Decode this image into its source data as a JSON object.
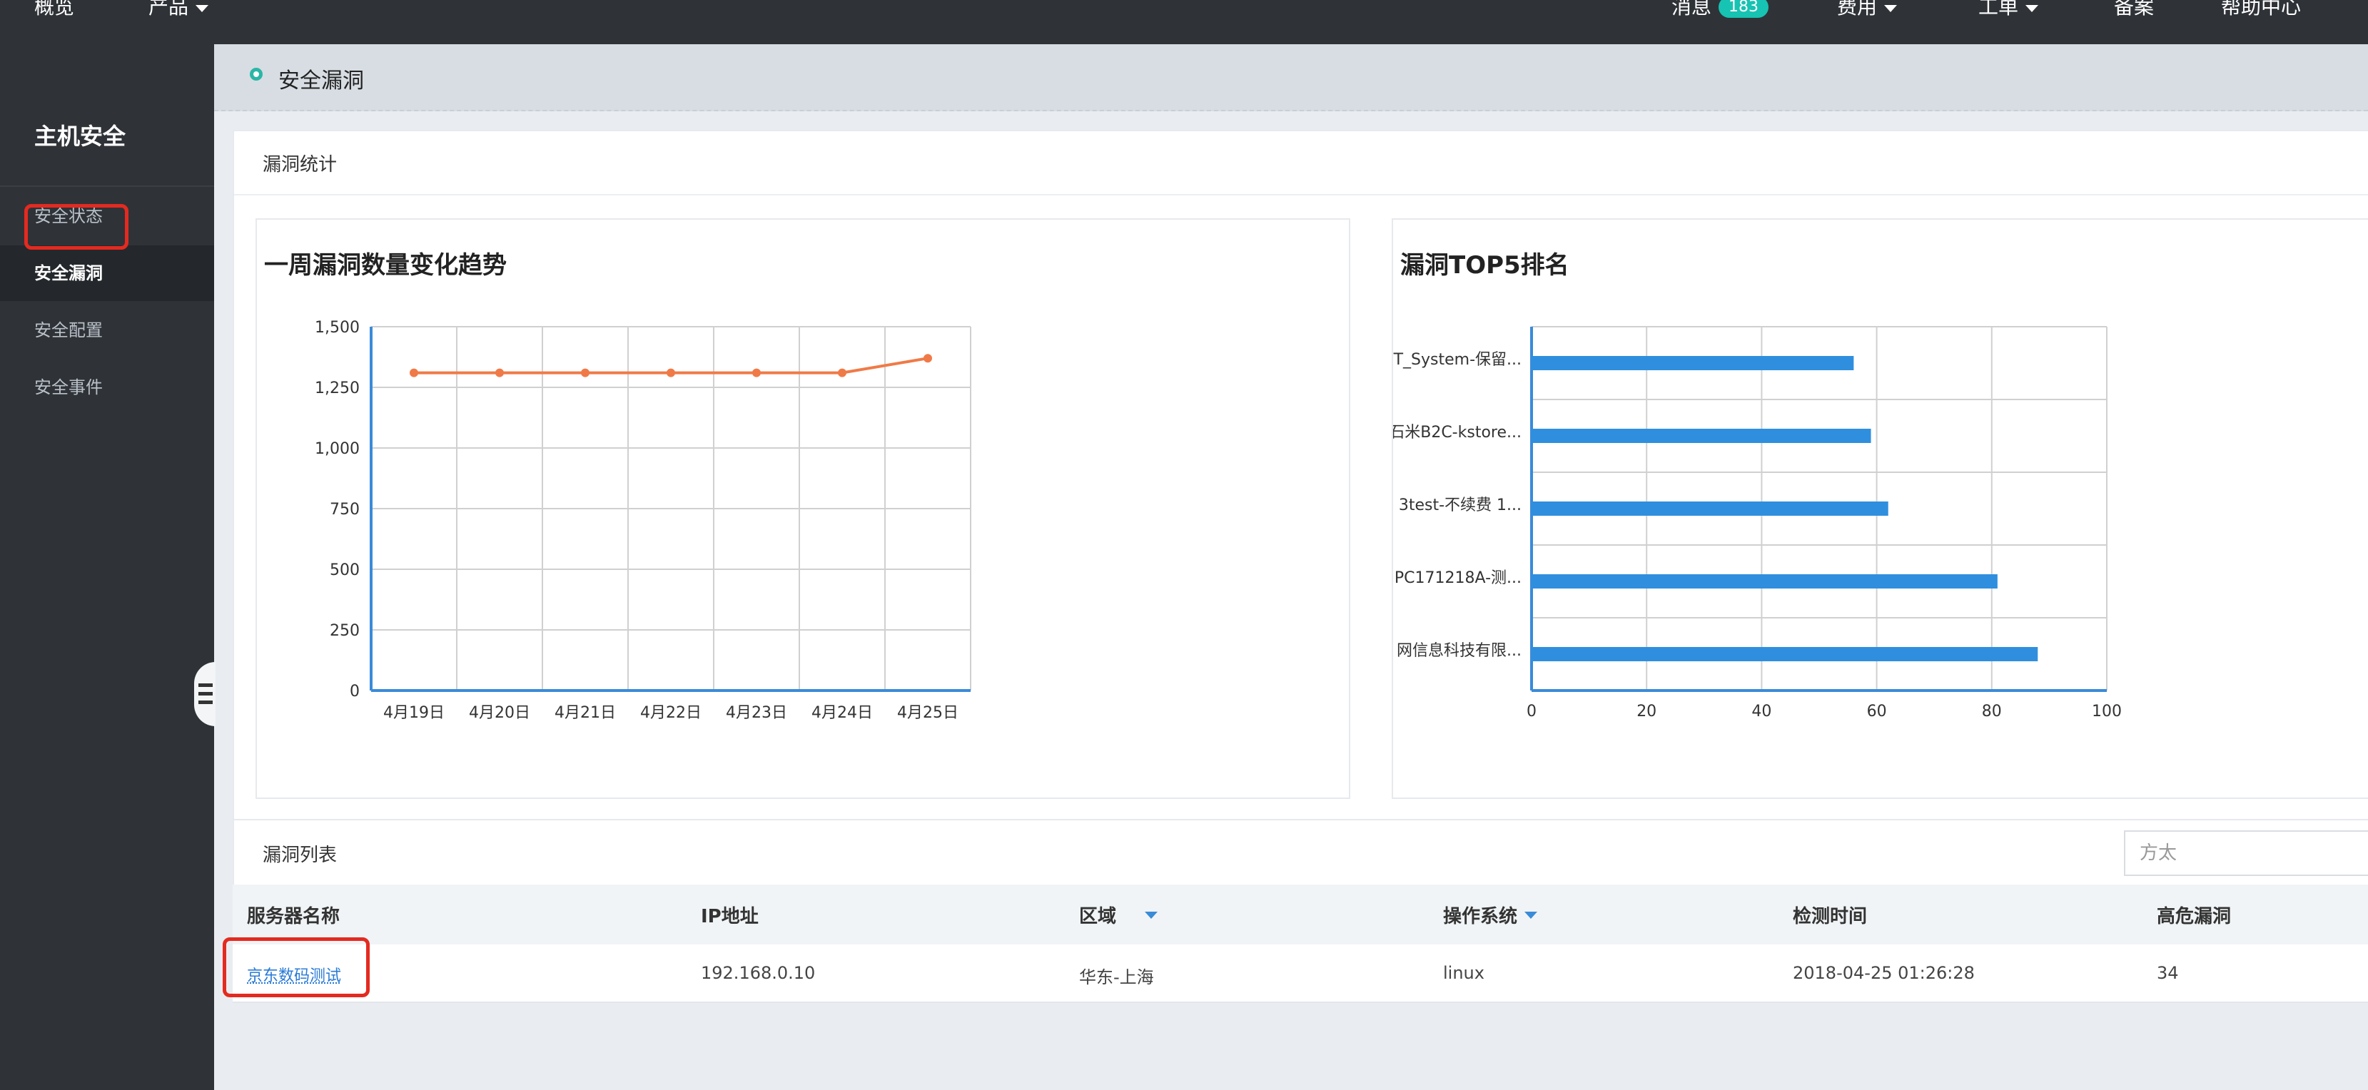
{
  "topnav": {
    "overview": "概览",
    "products": "产品",
    "messages": "消息",
    "messages_count": "183",
    "billing": "费用",
    "tickets": "工单",
    "filing": "备案",
    "help": "帮助中心"
  },
  "sidebar": {
    "title": "主机安全",
    "items": [
      {
        "label": "安全状态"
      },
      {
        "label": "安全漏洞"
      },
      {
        "label": "安全配置"
      },
      {
        "label": "安全事件"
      }
    ]
  },
  "page": {
    "title": "安全漏洞"
  },
  "stats_card": {
    "title": "漏洞统计"
  },
  "line_chart": {
    "title": "一周漏洞数量变化趋势"
  },
  "bar_chart": {
    "title": "漏洞TOP5排名"
  },
  "chart_data": [
    {
      "type": "line",
      "title": "一周漏洞数量变化趋势",
      "categories": [
        "4月19日",
        "4月20日",
        "4月21日",
        "4月22日",
        "4月23日",
        "4月24日",
        "4月25日"
      ],
      "series": [
        {
          "values": [
            1310,
            1310,
            1310,
            1310,
            1310,
            1310,
            1370
          ]
        }
      ],
      "ylim": [
        0,
        1500
      ],
      "yticks": [
        "0",
        "250",
        "500",
        "750",
        "1,000",
        "1,250",
        "1,500"
      ],
      "grid": true,
      "color": "#f07a47"
    },
    {
      "type": "bar",
      "orientation": "horizontal",
      "title": "漏洞TOP5排名",
      "categories": [
        "T_System-保留...",
        "石米B2C-kstore...",
        "3test-不续费 1...",
        "PC171218A-测...",
        "网信息科技有限..."
      ],
      "values": [
        56,
        59,
        62,
        81,
        88
      ],
      "xlim": [
        0,
        100
      ],
      "xticks": [
        "0",
        "20",
        "40",
        "60",
        "80",
        "100"
      ],
      "grid": true,
      "color": "#2f8fde"
    }
  ],
  "list_card": {
    "title": "漏洞列表",
    "search_placeholder": "方太"
  },
  "table": {
    "columns": [
      "服务器名称",
      "IP地址",
      "区域",
      "操作系统",
      "检测时间",
      "高危漏洞"
    ],
    "rows": [
      {
        "server": "京东数码测试",
        "ip": "192.168.0.10",
        "region": "华东-上海",
        "os": "linux",
        "time": "2018-04-25 01:26:28",
        "high": "34"
      }
    ]
  },
  "colors": {
    "accent": "#2bb6a6",
    "highlight": "#e42a20",
    "link": "#2b7bd6"
  }
}
